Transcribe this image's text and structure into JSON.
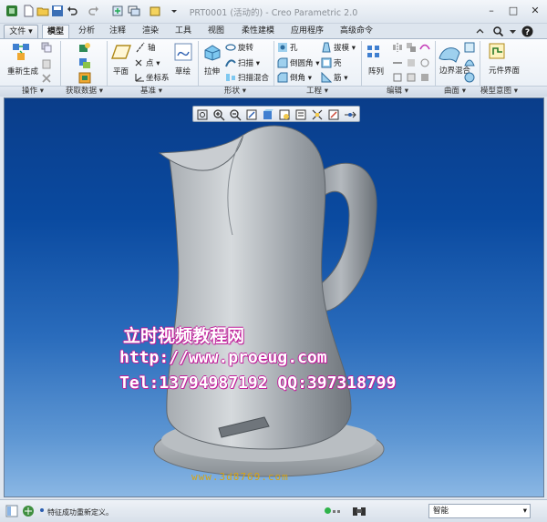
{
  "window": {
    "title": "PRT0001 (活动的) - Creo Parametric 2.0"
  },
  "tabs": [
    "文件",
    "模型",
    "分析",
    "注释",
    "渲染",
    "工具",
    "视图",
    "柔性建模",
    "应用程序",
    "高级命令"
  ],
  "ribbon": {
    "regenerate": "重新生成",
    "plane": "平面",
    "axis": "轴",
    "point": "点",
    "coord_sys": "坐标系",
    "sketch": "草绘",
    "extrude": "拉伸",
    "revolve": "旋转",
    "sweep": "扫描",
    "swept_blend": "扫描混合",
    "hole": "孔",
    "round": "倒圆角",
    "chamfer": "倒角",
    "draft": "拔模",
    "shell": "壳",
    "rib": "筋",
    "pattern": "阵列",
    "boundary_blend": "边界混合",
    "component_interface": "元件界面"
  },
  "groups": [
    "操作",
    "获取数据",
    "基准",
    "形状",
    "工程",
    "编辑",
    "曲面",
    "模型意图"
  ],
  "watermark": {
    "line1": "立时视频教程网",
    "line2": "http://www.proeug.com",
    "line3": "Tel:13794987192  QQ:397318799",
    "line4": "www.3d8769.com"
  },
  "status": {
    "message": "特征成功重新定义。",
    "filter": "智能"
  },
  "colors": {
    "accent": "#1d4f96",
    "watermark": "#c01d9a"
  }
}
